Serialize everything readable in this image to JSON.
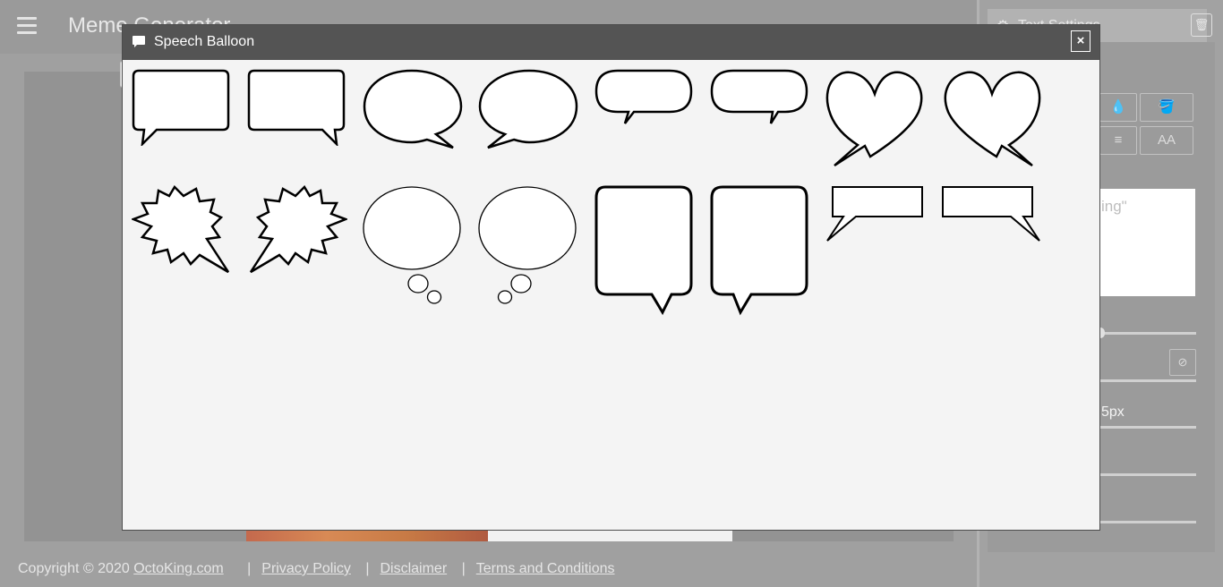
{
  "app": {
    "title": "Meme Generator",
    "menu_icon": "hamburger-icon"
  },
  "side_panel": {
    "title": "Text Settings",
    "title_icon": "gear-icon",
    "delete_icon": "trash-icon",
    "text_preview": "ing\"",
    "letter_case_label": "AA",
    "border_value": "5px"
  },
  "footer": {
    "copyright": "Copyright © 2020",
    "site_link": "OctoKing.com",
    "separator": "|",
    "privacy": "Privacy Policy",
    "disclaimer": "Disclaimer",
    "terms": "Terms and Conditions"
  },
  "modal": {
    "title": "Speech Balloon",
    "title_icon": "speech-bubble-icon",
    "close_label": "×",
    "balloon_stroke": "#000000",
    "balloon_fill": "#ffffff",
    "balloons": [
      {
        "name": "rectangle-tail-left",
        "shape": "rect"
      },
      {
        "name": "rectangle-tail-right",
        "shape": "rect"
      },
      {
        "name": "oval-tail-right",
        "shape": "oval"
      },
      {
        "name": "oval-tail-left",
        "shape": "oval"
      },
      {
        "name": "pill-tail-left",
        "shape": "pill"
      },
      {
        "name": "pill-tail-right",
        "shape": "pill"
      },
      {
        "name": "heart-tail-left",
        "shape": "heart"
      },
      {
        "name": "heart-tail-right",
        "shape": "heart"
      },
      {
        "name": "burst-tail-right",
        "shape": "burst"
      },
      {
        "name": "burst-tail-left",
        "shape": "burst"
      },
      {
        "name": "thought-bubbles-right",
        "shape": "thought"
      },
      {
        "name": "thought-bubbles-left",
        "shape": "thought"
      },
      {
        "name": "tall-rectangle-tail-right",
        "shape": "tall"
      },
      {
        "name": "tall-rectangle-tail-left",
        "shape": "tall"
      },
      {
        "name": "flat-box-tail-left",
        "shape": "flatbox"
      },
      {
        "name": "flat-box-tail-right",
        "shape": "flatbox"
      }
    ]
  }
}
